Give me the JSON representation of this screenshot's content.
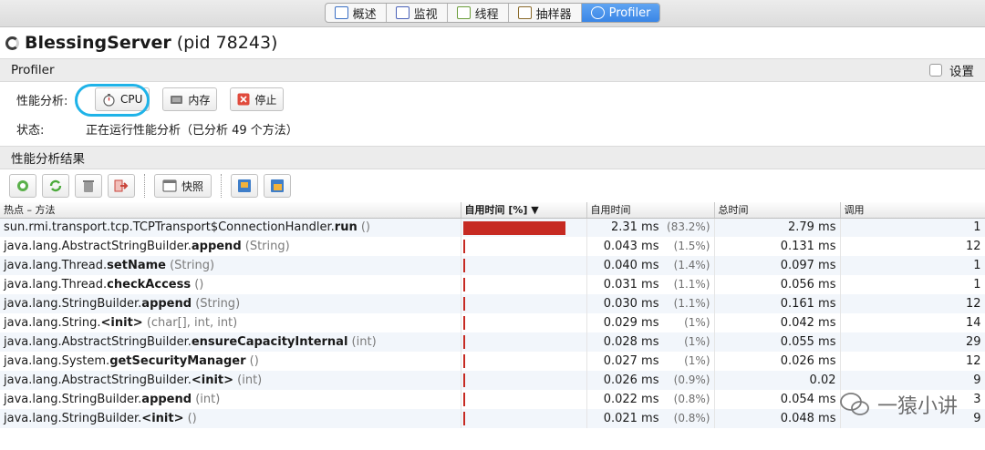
{
  "tabs": [
    {
      "label": "概述",
      "icon": "overview-icon",
      "color": "#3a6fc4",
      "active": false
    },
    {
      "label": "监视",
      "icon": "monitor-icon",
      "color": "#4a62b8",
      "active": false
    },
    {
      "label": "线程",
      "icon": "threads-icon",
      "color": "#6b9d3a",
      "active": false
    },
    {
      "label": "抽样器",
      "icon": "sampler-icon",
      "color": "#8a6a2a",
      "active": false
    },
    {
      "label": "Profiler",
      "icon": "profiler-icon",
      "color": "#ffffff",
      "active": true
    }
  ],
  "title": {
    "name": "BlessingServer",
    "pid": "(pid 78243)"
  },
  "profiler_section": {
    "label": "Profiler",
    "settings_label": "设置"
  },
  "controls": {
    "label": "性能分析:",
    "cpu": "CPU",
    "memory": "内存",
    "stop": "停止"
  },
  "status": {
    "label": "状态:",
    "value": "正在运行性能分析（已分析 49 个方法）"
  },
  "results_section": {
    "label": "性能分析结果"
  },
  "toolbar": {
    "snapshot": "快照"
  },
  "table": {
    "headers": [
      "热点 – 方法",
      "自用时间 [%] ▼",
      "自用时间",
      "总时间",
      "调用"
    ],
    "rows": [
      {
        "pre": "sun.rmi.transport.tcp.TCPTransport$ConnectionHandler.",
        "name": "run",
        "args": " ()",
        "share": 0.832,
        "self": "2.31 ms",
        "pct": "(83.2%)",
        "total": "2.79 ms",
        "calls": "1"
      },
      {
        "pre": "java.lang.AbstractStringBuilder.",
        "name": "append",
        "args": " (String)",
        "share": 0.015,
        "self": "0.043 ms",
        "pct": "(1.5%)",
        "total": "0.131 ms",
        "calls": "12"
      },
      {
        "pre": "java.lang.Thread.",
        "name": "setName",
        "args": " (String)",
        "share": 0.014,
        "self": "0.040 ms",
        "pct": "(1.4%)",
        "total": "0.097 ms",
        "calls": "1"
      },
      {
        "pre": "java.lang.Thread.",
        "name": "checkAccess",
        "args": " ()",
        "share": 0.011,
        "self": "0.031 ms",
        "pct": "(1.1%)",
        "total": "0.056 ms",
        "calls": "1"
      },
      {
        "pre": "java.lang.StringBuilder.",
        "name": "append",
        "args": " (String)",
        "share": 0.011,
        "self": "0.030 ms",
        "pct": "(1.1%)",
        "total": "0.161 ms",
        "calls": "12"
      },
      {
        "pre": "java.lang.String.",
        "name": "<init>",
        "args": " (char[], int, int)",
        "share": 0.01,
        "self": "0.029 ms",
        "pct": "(1%)",
        "total": "0.042 ms",
        "calls": "14"
      },
      {
        "pre": "java.lang.AbstractStringBuilder.",
        "name": "ensureCapacityInternal",
        "args": " (int)",
        "share": 0.01,
        "self": "0.028 ms",
        "pct": "(1%)",
        "total": "0.055 ms",
        "calls": "29"
      },
      {
        "pre": "java.lang.System.",
        "name": "getSecurityManager",
        "args": " ()",
        "share": 0.01,
        "self": "0.027 ms",
        "pct": "(1%)",
        "total": "0.026 ms",
        "calls": "12"
      },
      {
        "pre": "java.lang.AbstractStringBuilder.",
        "name": "<init>",
        "args": " (int)",
        "share": 0.009,
        "self": "0.026 ms",
        "pct": "(0.9%)",
        "total": "0.02",
        "calls": "9"
      },
      {
        "pre": "java.lang.StringBuilder.",
        "name": "append",
        "args": " (int)",
        "share": 0.008,
        "self": "0.022 ms",
        "pct": "(0.8%)",
        "total": "0.054 ms",
        "calls": "3"
      },
      {
        "pre": "java.lang.StringBuilder.",
        "name": "<init>",
        "args": " ()",
        "share": 0.008,
        "self": "0.021 ms",
        "pct": "(0.8%)",
        "total": "0.048 ms",
        "calls": "9"
      }
    ]
  },
  "watermark": "一猿小讲",
  "colors": {
    "bar": "#c62a22",
    "active_tab": "#3a86e6",
    "highlight_ring": "#1fb3e8"
  }
}
